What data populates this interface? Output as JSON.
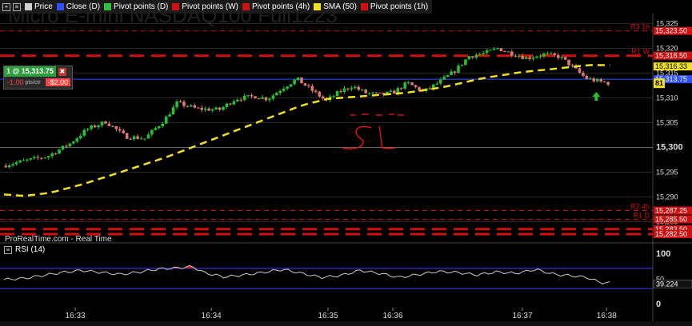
{
  "watermark": "Micro E-mini NASDAQ100 Full1223",
  "toolbar": {
    "legend": [
      {
        "label": "Price",
        "color": "#d0d0d0"
      },
      {
        "label": "Close (D)",
        "color": "#3050ff"
      },
      {
        "label": "Pivot points (D)",
        "color": "#30c040"
      },
      {
        "label": "Pivot points (W)",
        "color": "#d01010"
      },
      {
        "label": "Pivot points (4h)",
        "color": "#d01010"
      },
      {
        "label": "SMA (50)",
        "color": "#f0e020"
      },
      {
        "label": "Pivot points (1h)",
        "color": "#d01010"
      }
    ]
  },
  "position": {
    "qty": "1 @ 15,313.75",
    "close": "✖",
    "points": "-1.00",
    "unit": "pts/ctr",
    "usd": "-$2.00"
  },
  "source": "ProRealTime.com - Real Time",
  "rsi_label": "RSI (14)",
  "colors": {
    "up": "#26c22e",
    "down": "#e07878",
    "sma": "#f0e020",
    "pivot": "#d01010",
    "close_d": "#3050ff",
    "rsi_line": "#cccccc",
    "rsi_band": "#4040ff",
    "overbought_fill": "#c02020",
    "annotation": "#ff1010"
  },
  "chart_data": {
    "type": "candlestick",
    "price_axis": {
      "min": 15282.5,
      "max": 15327,
      "ticks": [
        15325,
        15320,
        15315,
        15310,
        15305,
        15300,
        15295,
        15290,
        15285
      ],
      "tick_labels": [
        "15,325",
        "15,320",
        "15,315",
        "15,310",
        "15,305",
        "15,300",
        "15,295",
        "15,290",
        "15,285"
      ],
      "major_ticks": [
        "15,300"
      ]
    },
    "time_axis": {
      "ticks": [
        {
          "label": "16:33",
          "t": 0.11
        },
        {
          "label": "16:34",
          "t": 0.32
        },
        {
          "label": "16:35",
          "t": 0.5
        },
        {
          "label": "16:36",
          "t": 0.6
        },
        {
          "label": "16:37",
          "t": 0.8
        },
        {
          "label": "16:38",
          "t": 0.93
        }
      ]
    },
    "price_anchors": [
      [
        0,
        15296.3
      ],
      [
        0.035,
        15297.3
      ],
      [
        0.07,
        15298.2
      ],
      [
        0.105,
        15300.8
      ],
      [
        0.13,
        15303.6
      ],
      [
        0.16,
        15305.2
      ],
      [
        0.19,
        15302.2
      ],
      [
        0.22,
        15301.8
      ],
      [
        0.25,
        15305.5
      ],
      [
        0.27,
        15309.0
      ],
      [
        0.3,
        15307.8
      ],
      [
        0.335,
        15307.6
      ],
      [
        0.36,
        15309.8
      ],
      [
        0.39,
        15310.3
      ],
      [
        0.41,
        15309.8
      ],
      [
        0.435,
        15312.2
      ],
      [
        0.455,
        15313.8
      ],
      [
        0.475,
        15311.8
      ],
      [
        0.5,
        15309.4
      ],
      [
        0.52,
        15311.2
      ],
      [
        0.54,
        15312.4
      ],
      [
        0.56,
        15311.0
      ],
      [
        0.585,
        15310.6
      ],
      [
        0.605,
        15311.2
      ],
      [
        0.625,
        15313.0
      ],
      [
        0.65,
        15311.2
      ],
      [
        0.675,
        15313.2
      ],
      [
        0.7,
        15315.6
      ],
      [
        0.72,
        15318.4
      ],
      [
        0.745,
        15319.0
      ],
      [
        0.765,
        15320.0
      ],
      [
        0.785,
        15319.0
      ],
      [
        0.81,
        15318.0
      ],
      [
        0.835,
        15318.8
      ],
      [
        0.86,
        15318.3
      ],
      [
        0.875,
        15316.8
      ],
      [
        0.9,
        15314.0
      ],
      [
        0.92,
        15313.3
      ],
      [
        0.935,
        15313.0
      ]
    ],
    "candle_count": 170,
    "seed": 7,
    "series": [
      {
        "name": "SMA (50)",
        "points": [
          [
            0,
            15290.5
          ],
          [
            0.03,
            15290.2
          ],
          [
            0.07,
            15290.8
          ],
          [
            0.12,
            15292.5
          ],
          [
            0.18,
            15295.0
          ],
          [
            0.25,
            15298.0
          ],
          [
            0.32,
            15301.5
          ],
          [
            0.4,
            15305.5
          ],
          [
            0.46,
            15308.5
          ],
          [
            0.5,
            15309.8
          ],
          [
            0.56,
            15310.4
          ],
          [
            0.62,
            15311.0
          ],
          [
            0.68,
            15312.2
          ],
          [
            0.74,
            15314.0
          ],
          [
            0.8,
            15315.2
          ],
          [
            0.86,
            15316.0
          ],
          [
            0.9,
            15316.6
          ],
          [
            0.935,
            15316.6
          ]
        ]
      }
    ],
    "levels": [
      {
        "label": "R3 1h",
        "value": 15323.5,
        "box": "15,323.50",
        "style": "thin-dashed"
      },
      {
        "label": "R1 W",
        "value": 15318.5,
        "box": "15,318.50",
        "style": "thick-dashed"
      },
      {
        "label": "",
        "value": 15316.33,
        "box": "15,316.33",
        "style": "sma"
      },
      {
        "label": "",
        "value": 15313.75,
        "box": "15,313.75",
        "style": "close-d"
      },
      {
        "label": "R2 4h",
        "value": 15287.25,
        "box": "15,287.25",
        "style": "thin-dashed"
      },
      {
        "label": "R1 D",
        "value": 15285.5,
        "box": "15,285.50",
        "style": "thin-dashed"
      },
      {
        "label": "",
        "value": 15283.5,
        "box": "15,283.50",
        "style": "thick-dashed"
      },
      {
        "label": "",
        "value": 15282.5,
        "box": "15,282.50",
        "style": "thick-dashed"
      }
    ],
    "current_price_label": "81",
    "annotation_text": "SL",
    "rsi": {
      "ticks": [
        100,
        50,
        0
      ],
      "tick_labels": [
        "100",
        "50",
        "0"
      ],
      "bands": [
        70,
        30
      ],
      "current_label": "39.224",
      "points": [
        [
          0,
          48
        ],
        [
          0.03,
          50
        ],
        [
          0.06,
          56
        ],
        [
          0.09,
          62
        ],
        [
          0.12,
          66
        ],
        [
          0.15,
          62
        ],
        [
          0.18,
          58
        ],
        [
          0.21,
          63
        ],
        [
          0.24,
          69
        ],
        [
          0.27,
          71
        ],
        [
          0.29,
          74
        ],
        [
          0.31,
          61
        ],
        [
          0.34,
          53
        ],
        [
          0.37,
          57
        ],
        [
          0.4,
          62
        ],
        [
          0.43,
          68
        ],
        [
          0.46,
          60
        ],
        [
          0.49,
          52
        ],
        [
          0.52,
          56
        ],
        [
          0.55,
          66
        ],
        [
          0.58,
          60
        ],
        [
          0.61,
          52
        ],
        [
          0.64,
          58
        ],
        [
          0.67,
          64
        ],
        [
          0.7,
          62
        ],
        [
          0.73,
          57
        ],
        [
          0.76,
          63
        ],
        [
          0.79,
          60
        ],
        [
          0.82,
          68
        ],
        [
          0.85,
          58
        ],
        [
          0.88,
          55
        ],
        [
          0.9,
          52
        ],
        [
          0.92,
          42
        ],
        [
          0.935,
          41
        ]
      ]
    }
  }
}
